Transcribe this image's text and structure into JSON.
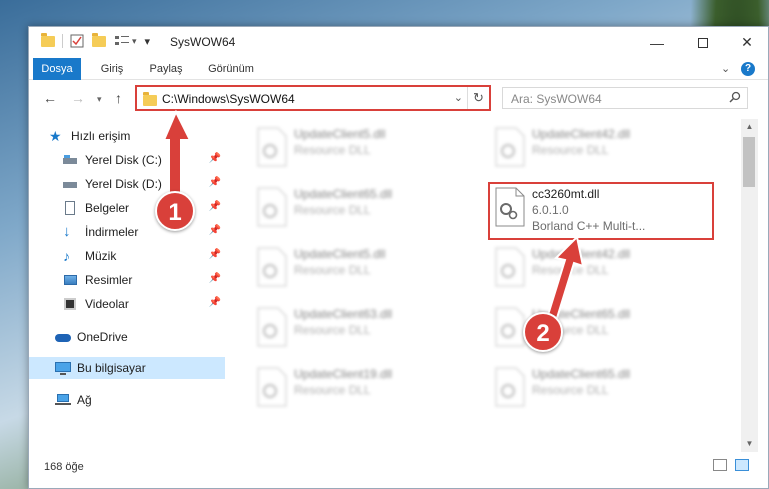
{
  "window": {
    "title": "SysWOW64",
    "minimize_icon": "minimize-icon",
    "maximize_icon": "maximize-icon",
    "close_icon": "close-icon"
  },
  "ribbon": {
    "tabs": [
      {
        "label": "Dosya"
      },
      {
        "label": "Giriş"
      },
      {
        "label": "Paylaş"
      },
      {
        "label": "Görünüm"
      }
    ]
  },
  "address": {
    "path": "C:\\Windows\\SysWOW64"
  },
  "search": {
    "placeholder": "Ara: SysWOW64"
  },
  "navpane": {
    "quick_access": "Hızlı erişim",
    "items": [
      {
        "label": "Yerel Disk (C:)"
      },
      {
        "label": "Yerel Disk (D:)"
      },
      {
        "label": "Belgeler"
      },
      {
        "label": "İndirmeler"
      },
      {
        "label": "Müzik"
      },
      {
        "label": "Resimler"
      },
      {
        "label": "Videolar"
      }
    ],
    "onedrive": "OneDrive",
    "this_pc": "Bu bilgisayar",
    "network": "Ağ"
  },
  "files": {
    "left": [
      {
        "name": "UpdateClient5.dll",
        "sub": "Resource DLL"
      },
      {
        "name": "UpdateClient65.dll",
        "sub": "Resource DLL"
      },
      {
        "name": "UpdateClient5.dll",
        "sub": "Resource DLL"
      },
      {
        "name": "UpdateClient63.dll",
        "sub": "Resource DLL"
      },
      {
        "name": "UpdateClient19.dll",
        "sub": "Resource DLL"
      }
    ],
    "right": [
      {
        "name": "UpdateClient42.dll",
        "sub": "Resource DLL"
      },
      {
        "name": "UpdateClient42.dll",
        "sub": "Resource DLL"
      },
      {
        "name": "UpdateClient65.dll",
        "sub": "Resource DLL"
      },
      {
        "name": "UpdateClient65.dll",
        "sub": "Resource DLL"
      }
    ],
    "highlighted": {
      "name": "cc3260mt.dll",
      "version": "6.0.1.0",
      "description": "Borland C++ Multi-t..."
    }
  },
  "status": {
    "count": "168 öğe"
  },
  "annotations": {
    "badge1": "1",
    "badge2": "2",
    "color": "#d9403a"
  }
}
